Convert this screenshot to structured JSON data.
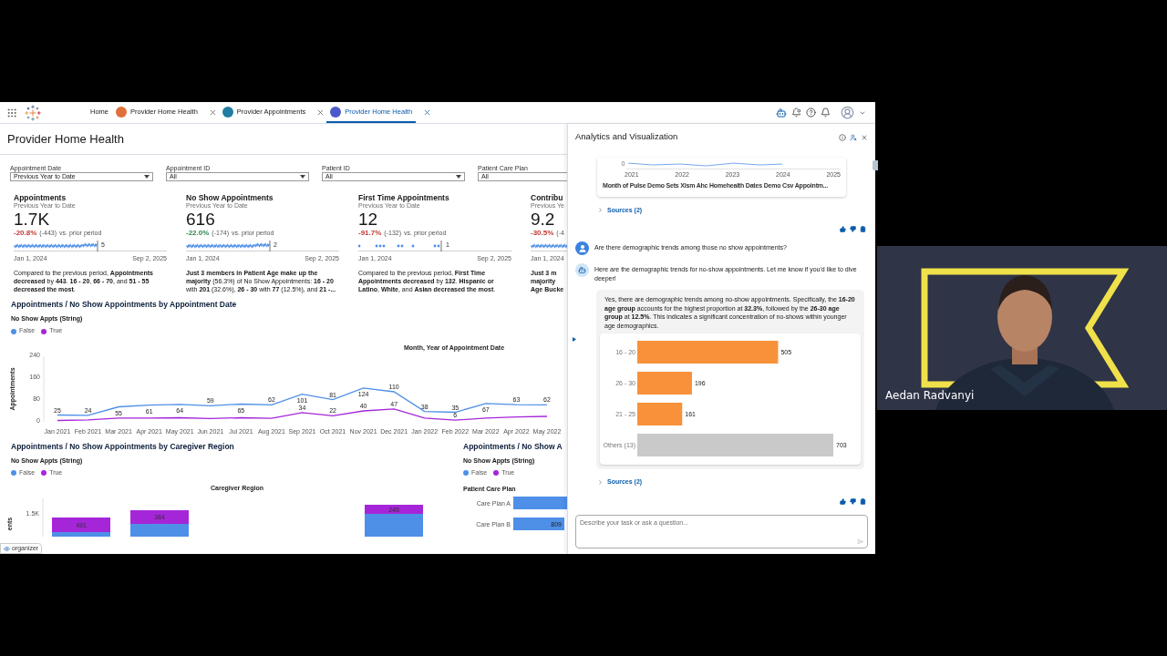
{
  "nav": {
    "tabs": [
      {
        "label": "Home",
        "closable": false,
        "selected": false
      },
      {
        "label": "Provider Home Health",
        "color": "#e0703a",
        "closable": true,
        "selected": false
      },
      {
        "label": "Provider Appointments",
        "color": "#1f7ea1",
        "closable": true,
        "selected": false
      },
      {
        "label": "Provider Home Health",
        "color": "#4b5ac8",
        "closable": true,
        "selected": true
      }
    ]
  },
  "page": {
    "title": "Provider Home Health",
    "filters": [
      {
        "label": "Appointment Date",
        "value": "Previous Year to Date"
      },
      {
        "label": "Appointment ID",
        "value": "All"
      },
      {
        "label": "Patient ID",
        "value": "All"
      },
      {
        "label": "Patient Care Plan",
        "value": "All"
      }
    ],
    "kpis": [
      {
        "kind": "line",
        "title": "Appointments",
        "period": "Previous Year to Date",
        "value": "1.7K",
        "change": "-20.8%",
        "color": "#c23934",
        "delta": "(-443)",
        "suffix": "vs. prior period",
        "last": "5",
        "start": "Jan 1, 2024",
        "end": "Sep 2, 2025",
        "summary": "Compared to the previous period, **Appointments decreased** by **443**. **16 - 20**, **66 - 70**, and **51 - 55 decreased the most**."
      },
      {
        "kind": "line",
        "title": "No Show Appointments",
        "period": "Previous Year to Date",
        "value": "616",
        "change": "-22.0%",
        "color": "#2e844a",
        "delta": "(-174)",
        "suffix": "vs. prior period",
        "last": "2",
        "start": "Jan 1, 2024",
        "end": "Sep 2, 2025",
        "summary": "**Just 3 members in Patient Age make up the majority** (56.3%) of No Show Appointments: **16 - 20** with **201** (32.6%), **26 - 30** with **77** (12.5%), and **21 -...**"
      },
      {
        "kind": "dots",
        "title": "First Time Appointments",
        "period": "Previous Year to Date",
        "value": "12",
        "change": "-91.7%",
        "color": "#c23934",
        "delta": "(-132)",
        "suffix": "vs. prior period",
        "last": "1",
        "start": "Jan 1, 2024",
        "end": "Sep 2, 2025",
        "summary": "Compared to the previous period, **First Time Appointments decreased** by **132**. **Hispanic or Latino**, **White**, and **Asian decreased the most**."
      },
      {
        "kind": "line",
        "title": "Contribu",
        "period": "Previous Ye",
        "value": "9.2",
        "change": "-30.5%",
        "color": "#c23934",
        "delta": "(-4",
        "start": "Jan 1, 2024",
        "summary": "**Just 3 m**\n**majority**\n**Age Bucke**"
      }
    ],
    "trend": {
      "title": "Appointments / No Show Appointments by Appointment Date",
      "legend_title": "No Show Appts (String)",
      "chart_data": {
        "type": "line",
        "xlabel": "Month, Year of Appointment Date",
        "ylabel": "Appointments",
        "categories": [
          "Jan 2021",
          "Feb 2021",
          "Mar 2021",
          "Apr 2021",
          "May 2021",
          "Jun 2021",
          "Jul 2021",
          "Aug 2021",
          "Sep 2021",
          "Oct 2021",
          "Nov 2021",
          "Dec 2021",
          "Jan 2022",
          "Feb 2022",
          "Mar 2022",
          "Apr 2022",
          "May 2022"
        ],
        "ylim": [
          0,
          240
        ],
        "yticks": [
          0,
          80,
          160,
          240
        ],
        "series": [
          {
            "name": "False",
            "color": "#4e8fe8",
            "values": [
              25,
              24,
              55,
              61,
              64,
              59,
              65,
              62,
              101,
              81,
              124,
              110,
              38,
              35,
              67,
              63,
              62
            ],
            "value_labels": [
              "25",
              "24",
              "55",
              "61",
              "64",
              "59",
              "65",
              "62",
              "101",
              "81",
              "124",
              "110",
              "38",
              "35",
              "67",
              "63",
              "62"
            ]
          },
          {
            "name": "True",
            "color": "#a526d8",
            "values": [
              5,
              7,
              14,
              14,
              15,
              12,
              15,
              13,
              34,
              22,
              40,
              47,
              14,
              6,
              14,
              18,
              20
            ],
            "value_labels": [
              null,
              null,
              null,
              null,
              null,
              null,
              null,
              null,
              "34",
              "22",
              "40",
              "47",
              null,
              "6",
              null,
              null,
              null
            ]
          }
        ]
      }
    },
    "region": {
      "title": "Appointments / No Show Appointments by Caregiver Region",
      "legend_title": "No Show Appts (String)",
      "legend": [
        {
          "label": "False",
          "color": "#4e8fe8"
        },
        {
          "label": "True",
          "color": "#a526d8"
        }
      ],
      "axis_title": "Caregiver Region",
      "value_axis_title": "ents",
      "tick": "1.5K",
      "bar_labels": [
        "491",
        "384",
        "245"
      ]
    },
    "plan": {
      "title": "Appointments / No Show A",
      "legend_title": "No Show Appts (String)",
      "legend": [
        {
          "label": "False",
          "color": "#4e8fe8"
        },
        {
          "label": "True",
          "color": "#a526d8"
        }
      ],
      "axis_title": "Patient Care Plan",
      "rows": [
        {
          "label": "Care Plan A"
        },
        {
          "label": "Care Plan B",
          "value_label": "809"
        }
      ]
    },
    "organizer": "organizer"
  },
  "panel": {
    "title": "Analytics and Visualization",
    "items": [
      {
        "kind": "chart_card",
        "ytick": "0",
        "xticks": [
          "2021",
          "2022",
          "2023",
          "2024",
          "2025"
        ],
        "xlabel": "Month of Pulse Demo Sets Xlsm Ahc Homehealth Dates Demo Csv Appointm..."
      },
      {
        "kind": "sources",
        "label": "Sources (2)",
        "expanded": false
      },
      {
        "kind": "feedback"
      },
      {
        "kind": "user",
        "text": "Are there demographic trends among those no show appointments?"
      },
      {
        "kind": "bot",
        "text": "Here are the demographic trends for no-show appointments. Let me know if you'd like to dive deeper!"
      },
      {
        "kind": "answer",
        "text": "Yes, there are demographic trends among no-show appointments. Specifically, the **16-20 age group** accounts for the highest proportion at **32.3%**, followed by the **26-30 age group** at **12.5%**. This indicates a significant concentration of no-shows within younger age demographics.",
        "chart_data": {
          "type": "bar",
          "orientation": "horizontal",
          "categories": [
            "16 - 20",
            "26 - 30",
            "21 - 25",
            "Others (13)"
          ],
          "data_labels": true,
          "series": [
            {
              "values": [
                505,
                196,
                161,
                703
              ],
              "colors": [
                "#f7923a",
                "#f7923a",
                "#f7923a",
                "#c9c9c9"
              ]
            }
          ]
        }
      },
      {
        "kind": "sources",
        "label": "Sources (2)",
        "expanded": false
      },
      {
        "kind": "feedback"
      }
    ],
    "input": {
      "placeholder": "Describe your task or ask a question..."
    }
  },
  "participant": {
    "name": "Aedan Radvanyi",
    "kind": "picture"
  }
}
